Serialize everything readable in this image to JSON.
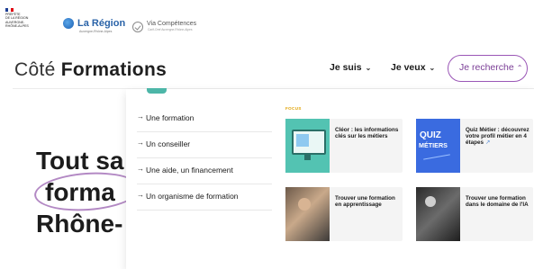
{
  "top_strip": {
    "prefet_lines": [
      "PRÉFÈTE",
      "DE LA RÉGION",
      "AUVERGNE-",
      "RHÔNE-ALPES"
    ],
    "region_brand": "La Région",
    "region_sub": "Auvergne-Rhône-Alpes",
    "vc_brand": "Via Compétences",
    "vc_sub": "Carif-Oref Auvergne-Rhône-Alpes"
  },
  "header": {
    "logo_part1": "Côté",
    "logo_part2": "Formations",
    "nav": [
      {
        "label": "Je suis",
        "chevron": "⌄"
      },
      {
        "label": "Je veux",
        "chevron": "⌄"
      },
      {
        "label": "Je recherche",
        "chevron": "⌃"
      }
    ]
  },
  "hero": {
    "line1": "Tout sa",
    "line2": "forma",
    "line3": "Rhône-"
  },
  "dropdown": {
    "menu_items": [
      "Une formation",
      "Un conseiller",
      "Une aide, un financement",
      "Un organisme de formation"
    ],
    "focus_label": "FOCUS",
    "cards": [
      {
        "title": "Cléor : les informations clés sur les métiers",
        "external": ""
      },
      {
        "title": "Quiz Métier : découvrez votre profil métier en 4 étapes",
        "external": "↗"
      },
      {
        "title": "Trouver une formation en apprentissage",
        "external": ""
      },
      {
        "title": "Trouver une formation dans le domaine de l'IA",
        "external": ""
      }
    ],
    "quiz_thumb": {
      "line1": "QUIZ",
      "line2": "MÉTIERS"
    }
  },
  "colors": {
    "accent_purple": "#9a56b6",
    "teal": "#4db6a8",
    "focus_yellow": "#e0a100",
    "quiz_blue": "#3a6be0"
  }
}
